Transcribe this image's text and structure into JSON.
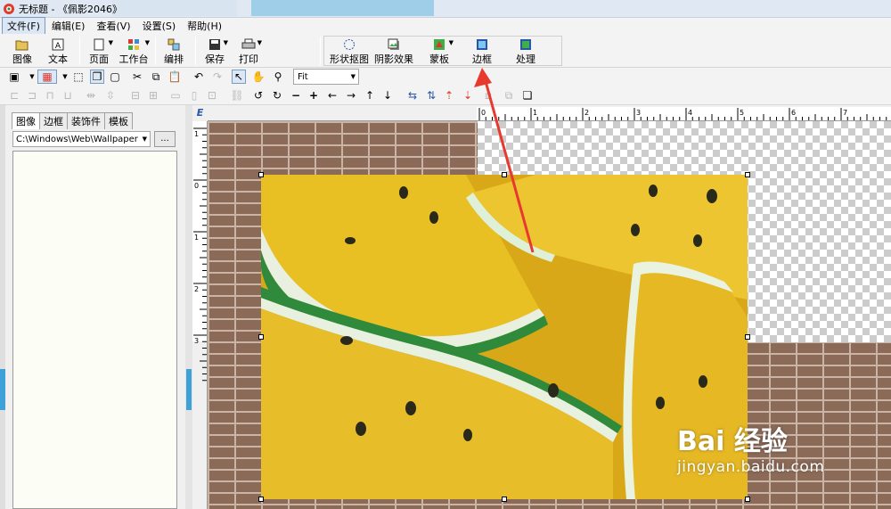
{
  "window": {
    "title": "无标题 - 《佩影2046》"
  },
  "menu": [
    "文件(F)",
    "编辑(E)",
    "查看(V)",
    "设置(S)",
    "帮助(H)"
  ],
  "main_toolbar": {
    "image": "图像",
    "text": "文本",
    "page": "页面",
    "workbench": "工作台",
    "arrange": "编排",
    "save": "保存",
    "print": "打印",
    "shape_cutout": "形状抠图",
    "shadow": "阴影效果",
    "mask": "蒙板",
    "border": "边框",
    "process": "处理"
  },
  "zoom": {
    "value": "Fit"
  },
  "left_panel": {
    "tabs": [
      "图像",
      "边框",
      "装饰件",
      "模板"
    ],
    "path": "C:\\Windows\\Web\\Wallpaper",
    "browse": "..."
  },
  "ruler": {
    "h_labels": [
      "0",
      "1",
      "2",
      "3",
      "4",
      "5",
      "6",
      "7"
    ],
    "v_labels": [
      "1",
      "0",
      "1",
      "2",
      "3"
    ],
    "corner": "E"
  },
  "watermark": {
    "brand": "Bai 经验",
    "site": "jingyan.baidu.com"
  },
  "colors": {
    "annotation_arrow": "#e8392e",
    "handle_blue": "#3ea2d8"
  }
}
